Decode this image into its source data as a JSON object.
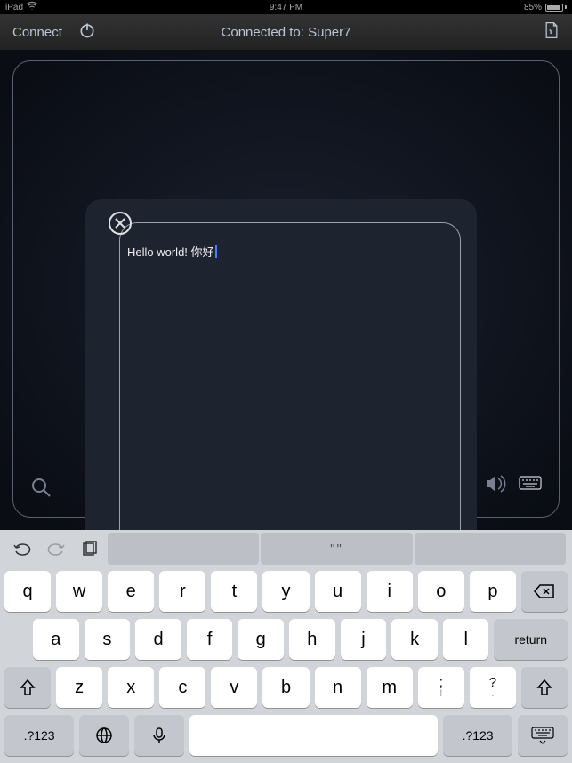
{
  "status": {
    "device": "iPad",
    "time": "9:47 PM",
    "battery_pct": "85%"
  },
  "nav": {
    "connect": "Connect",
    "title": "Connected to: Super7"
  },
  "text_panel": {
    "content": "Hello world! 你好"
  },
  "suggestions": {
    "mid": "\"\""
  },
  "keyboard": {
    "row1": [
      "q",
      "w",
      "e",
      "r",
      "t",
      "y",
      "u",
      "i",
      "o",
      "p"
    ],
    "row2": [
      "a",
      "s",
      "d",
      "f",
      "g",
      "h",
      "j",
      "k",
      "l"
    ],
    "return": "return",
    "row3": [
      "z",
      "x",
      "c",
      "v",
      "b",
      "n",
      "m"
    ],
    "row3_punct": [
      ";",
      "?"
    ],
    "row3_lower": [
      "!",
      "."
    ],
    "num_label": ".?123"
  }
}
